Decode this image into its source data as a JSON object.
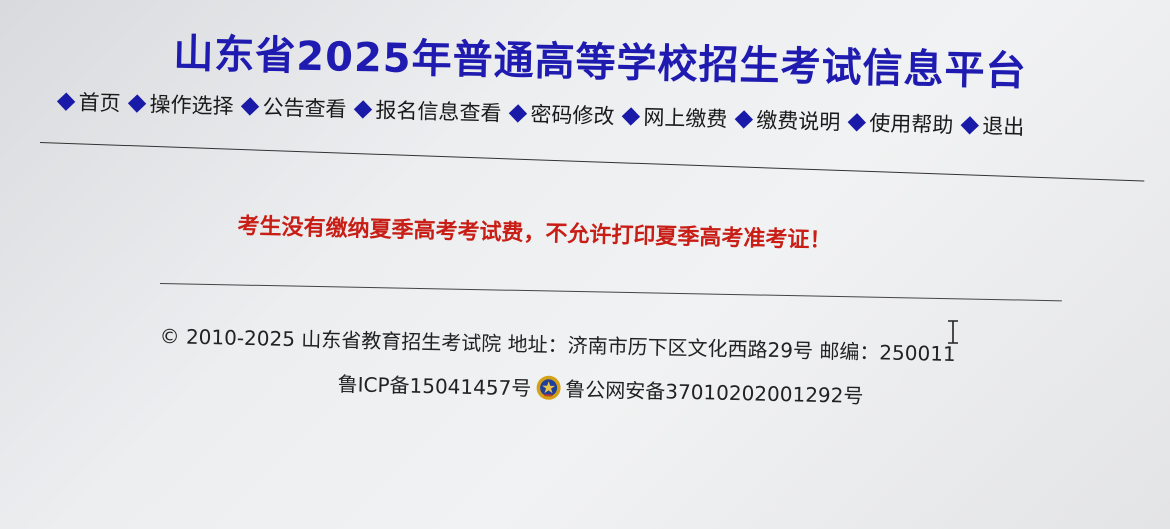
{
  "header": {
    "title": "山东省2025年普通高等学校招生考试信息平台"
  },
  "nav": {
    "items": [
      {
        "label": "首页"
      },
      {
        "label": "操作选择"
      },
      {
        "label": "公告查看"
      },
      {
        "label": "报名信息查看"
      },
      {
        "label": "密码修改"
      },
      {
        "label": "网上缴费"
      },
      {
        "label": "缴费说明"
      },
      {
        "label": "使用帮助"
      },
      {
        "label": "退出"
      }
    ]
  },
  "main": {
    "message": "考生没有缴纳夏季高考考试费，不允许打印夏季高考准考证！"
  },
  "footer": {
    "copyright": "© 2010-2025 山东省教育招生考试院 地址：济南市历下区文化西路29号 邮编：250011",
    "icp": "鲁ICP备15041457号",
    "police_record": "鲁公网安备37010202001292号",
    "emblem_icon": "police-emblem-icon"
  },
  "colors": {
    "title": "#1f1bb0",
    "message": "#c81e16",
    "diamond": "#1a1aa8"
  }
}
